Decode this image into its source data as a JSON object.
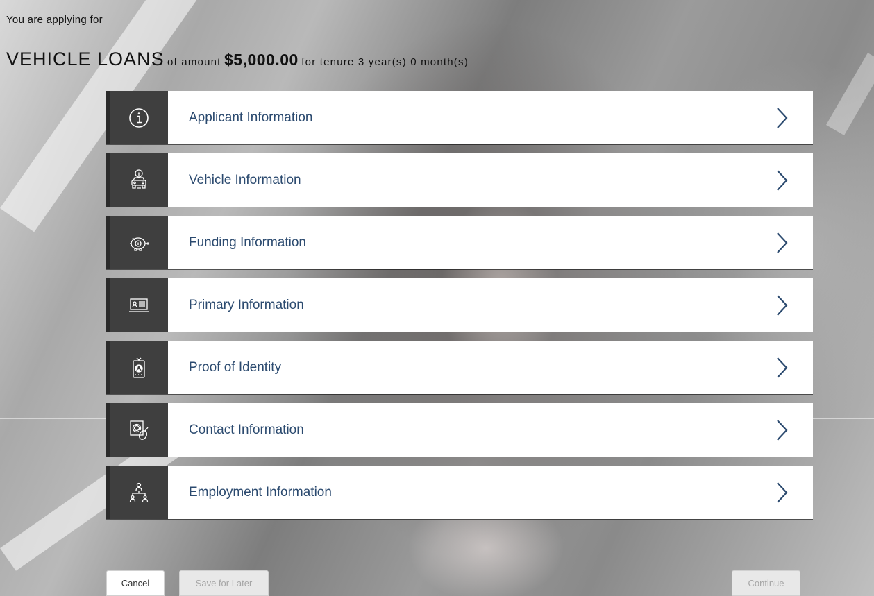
{
  "header": {
    "intro": "You are applying for",
    "product": "VEHICLE LOANS",
    "of_amount": "of amount",
    "amount": "$5,000.00",
    "tenure_text": "for tenure 3 year(s) 0 month(s)"
  },
  "sections": [
    {
      "label": "Applicant Information",
      "icon": "info-icon"
    },
    {
      "label": "Vehicle Information",
      "icon": "vehicle-icon"
    },
    {
      "label": "Funding Information",
      "icon": "piggy-bank-icon"
    },
    {
      "label": "Primary Information",
      "icon": "id-card-icon"
    },
    {
      "label": "Proof of Identity",
      "icon": "badge-icon"
    },
    {
      "label": "Contact Information",
      "icon": "email-mouse-icon"
    },
    {
      "label": "Employment Information",
      "icon": "org-chart-icon"
    }
  ],
  "actions": {
    "cancel": "Cancel",
    "save_for_later": "Save for Later",
    "continue": "Continue"
  },
  "colors": {
    "section_label": "#2b4a6f",
    "icon_box": "#3f3f3f",
    "chevron": "#2b4a6f"
  }
}
